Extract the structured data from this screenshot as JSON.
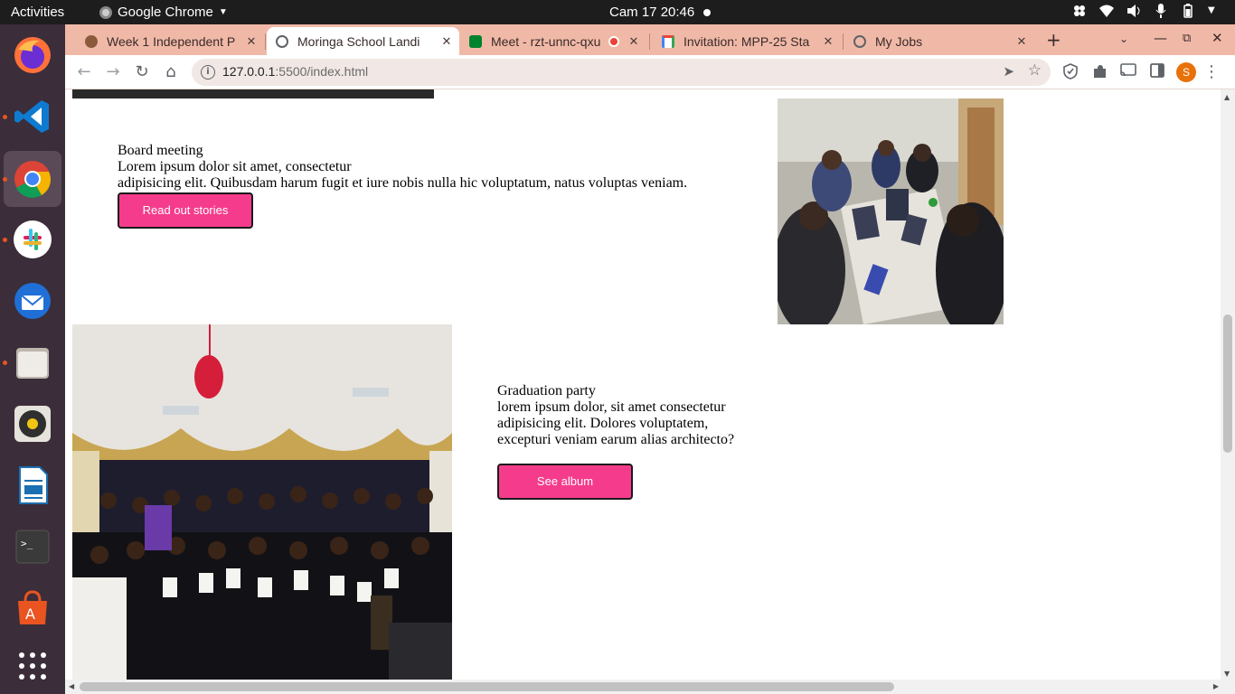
{
  "system_bar": {
    "activities": "Activities",
    "app_name": "Google Chrome",
    "clock": "Cam 17  20:46"
  },
  "dock": {
    "apps": [
      "firefox-icon",
      "vscode-icon",
      "chrome-icon",
      "slack-icon",
      "thunderbird-icon",
      "files-icon",
      "rhythmbox-icon",
      "libreoffice-writer-icon",
      "terminal-icon",
      "app-store-icon",
      "show-apps-icon"
    ]
  },
  "browser": {
    "tabs": [
      {
        "label": "Week 1 Independent P",
        "favicon_color": "#8b5a3c"
      },
      {
        "label": "Moringa School Landi",
        "favicon_color": "#5f6368"
      },
      {
        "label": "Meet - rzt-unnc-qxu",
        "favicon_color": "#00832d"
      },
      {
        "label": "Invitation: MPP-25 Sta",
        "favicon_color": "#d93025"
      },
      {
        "label": "My Jobs",
        "favicon_color": "#5f6368"
      }
    ],
    "active_tab_index": 1,
    "url_host": "127.0.0.1",
    "url_path": ":5500/index.html",
    "profile_initial": "S"
  },
  "page": {
    "board": {
      "title": "Board meeting",
      "line1": "Lorem ipsum dolor sit amet, consectetur",
      "line2": "adipisicing elit. Quibusdam harum fugit et iure nobis nulla hic voluptatum, natus voluptas veniam.",
      "button": "Read out stories"
    },
    "graduation": {
      "title": "Graduation party",
      "line1": "lorem ipsum dolor, sit amet consectetur",
      "line2": "adipisicing elit. Dolores voluptatem,",
      "line3": "excepturi veniam earum alias architecto?",
      "button": "See album"
    }
  },
  "colors": {
    "button_pink": "#f53c8c",
    "tab_strip": "#f0b9a7",
    "dock_bg": "#3b2d3a"
  }
}
